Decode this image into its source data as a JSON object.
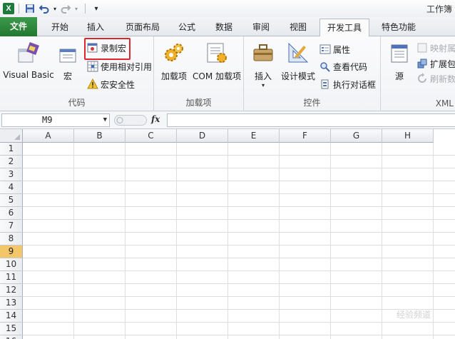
{
  "window": {
    "title": "工作簿"
  },
  "quick_access": {
    "items": [
      "excel-logo",
      "save",
      "undo",
      "redo",
      "customize"
    ]
  },
  "tabs": [
    {
      "label": "文件",
      "left": 0
    },
    {
      "label": "开始"
    },
    {
      "label": "插入"
    },
    {
      "label": "页面布局"
    },
    {
      "label": "公式"
    },
    {
      "label": "数据"
    },
    {
      "label": "审阅"
    },
    {
      "label": "视图"
    },
    {
      "label": "开发工具",
      "active": true
    },
    {
      "label": "特色功能"
    }
  ],
  "ribbon": {
    "code": {
      "label": "代码",
      "visual_basic": "Visual Basic",
      "macros": "宏",
      "record_macro": "录制宏",
      "relative_ref": "使用相对引用",
      "macro_security": "宏安全性"
    },
    "addins": {
      "label": "加载项",
      "addins": "加载项",
      "com_addins": "COM 加载项"
    },
    "controls": {
      "label": "控件",
      "insert": "插入",
      "design_mode": "设计模式",
      "properties": "属性",
      "view_code": "查看代码",
      "run_dialog": "执行对话框"
    },
    "xml": {
      "label": "XML",
      "source": "源",
      "map_properties": "映射属",
      "expansion_packs": "扩展包",
      "refresh_data": "刷新数"
    }
  },
  "formula_bar": {
    "name_box": "M9",
    "fx": "fx",
    "value": ""
  },
  "sheet": {
    "columns": [
      "A",
      "B",
      "C",
      "D",
      "E",
      "F",
      "G",
      "H"
    ],
    "rows": [
      "1",
      "2",
      "3",
      "4",
      "5",
      "6",
      "7",
      "8",
      "9",
      "10",
      "11",
      "12",
      "13",
      "14",
      "15",
      "16"
    ],
    "selected_row": "9"
  },
  "watermark": "经验频道"
}
